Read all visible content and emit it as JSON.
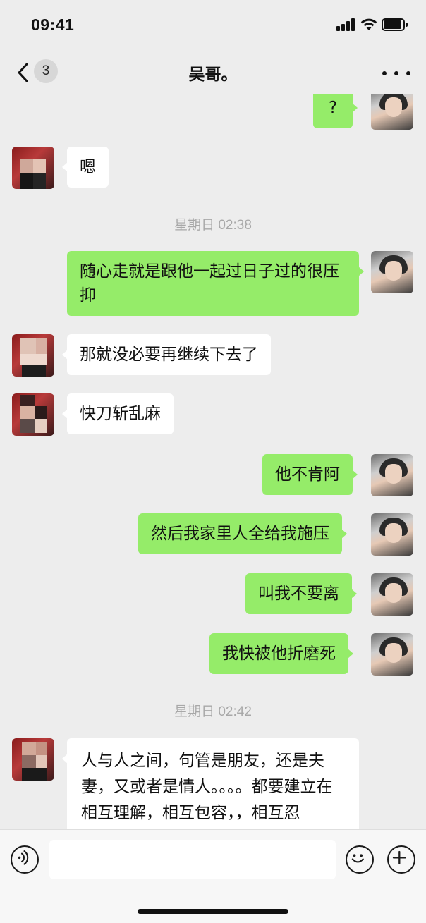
{
  "status_bar": {
    "time": "09:41"
  },
  "nav": {
    "unread_count": "3",
    "title": "吴哥。"
  },
  "messages": [
    {
      "side": "out",
      "text": "?"
    },
    {
      "side": "in",
      "text": "嗯"
    },
    {
      "type": "time",
      "text": "星期日 02:38"
    },
    {
      "side": "out",
      "text": "随心走就是跟他一起过日子过的很压抑"
    },
    {
      "side": "in",
      "text": "那就没必要再继续下去了"
    },
    {
      "side": "in",
      "text": "快刀斩乱麻"
    },
    {
      "side": "out",
      "text": "他不肯阿"
    },
    {
      "side": "out",
      "text": "然后我家里人全给我施压"
    },
    {
      "side": "out",
      "text": "叫我不要离"
    },
    {
      "side": "out",
      "text": "我快被他折磨死"
    },
    {
      "type": "time",
      "text": "星期日 02:42"
    },
    {
      "side": "in",
      "text": "人与人之间，句管是朋友，还是夫妻，又或者是情人。。。。都要建立在相互理解，相互包容，，相互忍让。。。。的基础之上"
    }
  ],
  "input_bar": {
    "placeholder": ""
  },
  "colors": {
    "background": "#ededed",
    "bubble_out": "#95ec69",
    "bubble_in": "#ffffff",
    "timestamp": "#a8a8a8"
  },
  "icons": [
    "back-chevron-icon",
    "more-icon",
    "voice-icon",
    "emoji-icon",
    "plus-icon",
    "signal-icon",
    "wifi-icon",
    "battery-icon"
  ]
}
